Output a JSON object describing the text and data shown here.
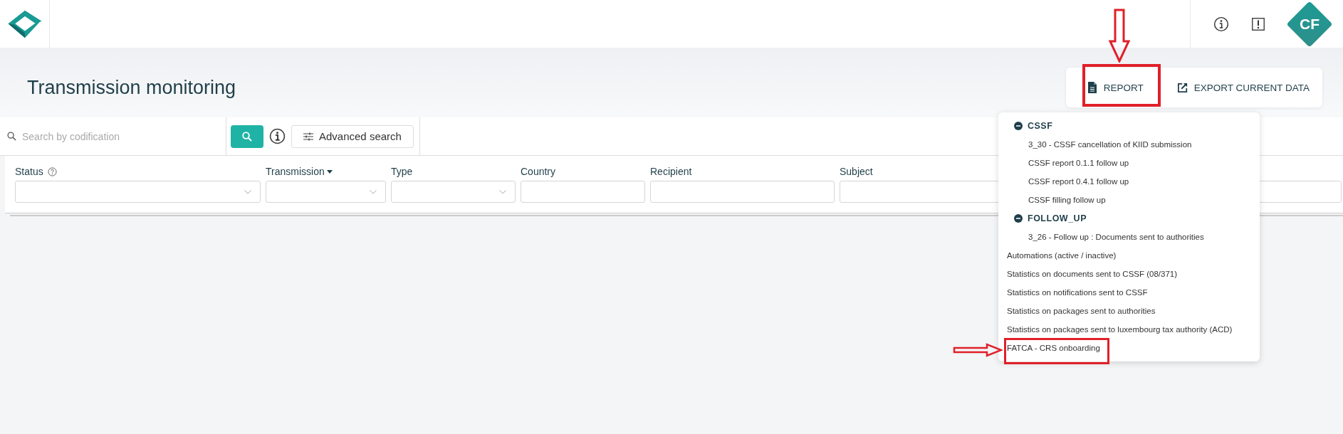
{
  "header": {
    "avatar": "CF"
  },
  "page": {
    "title": "Transmission monitoring"
  },
  "actions": [
    {
      "label": "REPORT",
      "kind": "report"
    },
    {
      "label": "EXPORT CURRENT DATA",
      "kind": "export"
    }
  ],
  "search": {
    "placeholder": "Search by codification",
    "advanced": "Advanced search"
  },
  "filters": [
    {
      "label": "Status",
      "kind": "select",
      "help": true
    },
    {
      "label": "Transmission",
      "kind": "select",
      "sorted": true
    },
    {
      "label": "Type",
      "kind": "select"
    },
    {
      "label": "Country",
      "kind": "text"
    },
    {
      "label": "Recipient",
      "kind": "text"
    },
    {
      "label": "Subject",
      "kind": "text"
    }
  ],
  "report_menu": {
    "groups": [
      {
        "title": "CSSF",
        "expanded": true,
        "items": [
          "3_30 - CSSF cancellation of KIID submission",
          "CSSF report 0.1.1 follow up",
          "CSSF report 0.4.1 follow up",
          "CSSF filling follow up"
        ]
      },
      {
        "title": "FOLLOW_UP",
        "expanded": true,
        "items": [
          "3_26 - Follow up : Documents sent to authorities"
        ]
      }
    ],
    "items": [
      "Automations (active / inactive)",
      "Statistics on documents sent to CSSF (08/371)",
      "Statistics on notifications sent to CSSF",
      "Statistics on packages sent to authorities",
      "Statistics on packages sent to luxembourg tax authority (ACD)",
      "FATCA - CRS onboarding"
    ]
  }
}
